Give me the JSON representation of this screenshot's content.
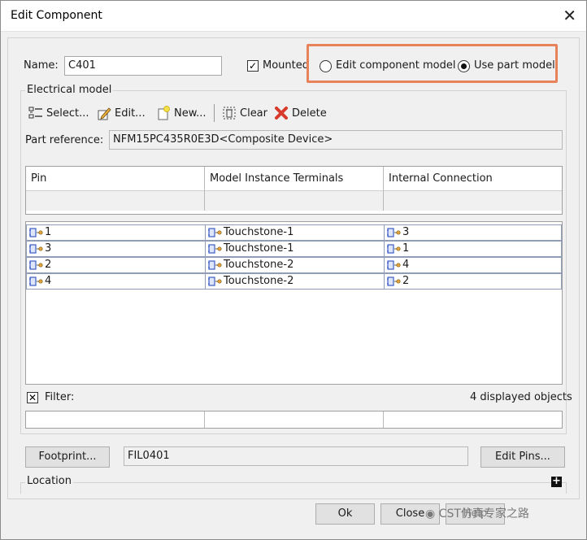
{
  "window": {
    "title": "Edit Component"
  },
  "name_field": {
    "label": "Name:",
    "value": "C401"
  },
  "mounted": {
    "label": "Mounted",
    "checked": true
  },
  "model_choice": {
    "edit_label": "Edit component model",
    "use_label": "Use part model",
    "selected": "use_part_model"
  },
  "electrical_model": {
    "title": "Electrical model",
    "toolbar": {
      "select_label": "Select...",
      "edit_label": "Edit...",
      "new_label": "New...",
      "clear_label": "Clear",
      "delete_label": "Delete"
    },
    "part_reference": {
      "label": "Part reference:",
      "value": "NFM15PC435R0E3D<Composite Device>"
    },
    "table": {
      "columns": [
        "Pin",
        "Model Instance Terminals",
        "Internal Connection"
      ],
      "rows": [
        {
          "pin": "1",
          "terminal": "Touchstone-1",
          "internal": "3"
        },
        {
          "pin": "3",
          "terminal": "Touchstone-1",
          "internal": "1"
        },
        {
          "pin": "2",
          "terminal": "Touchstone-2",
          "internal": "4"
        },
        {
          "pin": "4",
          "terminal": "Touchstone-2",
          "internal": "2"
        }
      ]
    },
    "filter": {
      "label": "Filter:",
      "status": "4 displayed objects"
    }
  },
  "footprint": {
    "button_label": "Footprint...",
    "value": "FIL0401",
    "edit_pins_label": "Edit Pins..."
  },
  "location": {
    "label": "Location"
  },
  "buttons": {
    "ok": "Ok",
    "close": "Close",
    "help": "Help"
  },
  "watermark": "CST仿真专家之路",
  "colors": {
    "highlight": "#e8825b",
    "pin_icon": "#3b5cc7",
    "delete_icon": "#d83a2b"
  }
}
